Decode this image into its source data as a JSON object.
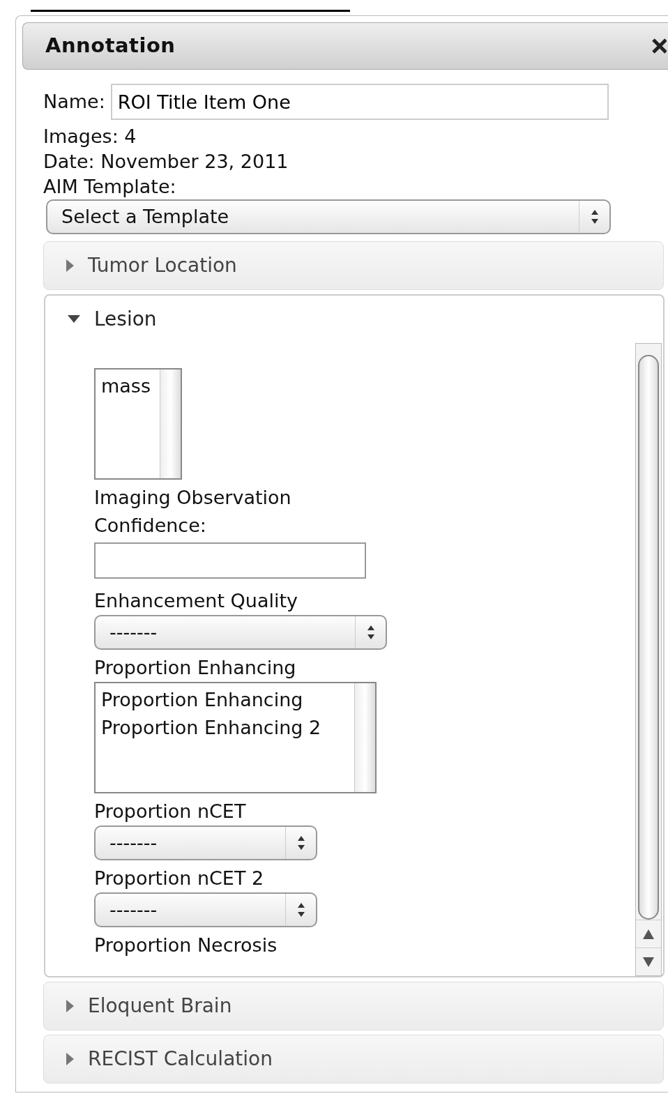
{
  "dialog": {
    "title": "Annotation",
    "name_label": "Name:",
    "name_value": "ROI Title Item One",
    "images": "Images: 4",
    "date": "Date: November 23, 2011",
    "template_label": "AIM Template:",
    "template_value": "Select a Template"
  },
  "sections": [
    {
      "title": "Tumor Location",
      "expanded": false
    },
    {
      "title": "Lesion",
      "expanded": true,
      "fields": [
        {
          "kind": "listbox",
          "options": [
            "mass"
          ]
        },
        {
          "kind": "text",
          "label": "Imaging Observation Confidence:"
        },
        {
          "kind": "select",
          "label": "Enhancement Quality",
          "value": "-------"
        },
        {
          "kind": "listbox",
          "label": "Proportion Enhancing",
          "options": [
            "Proportion Enhancing",
            "Proportion Enhancing 2"
          ]
        },
        {
          "kind": "select",
          "label": "Proportion nCET",
          "value": "-------"
        },
        {
          "kind": "select",
          "label": "Proportion nCET 2",
          "value": "-------"
        },
        {
          "kind": "label",
          "label": "Proportion Necrosis"
        }
      ]
    },
    {
      "title": "Eloquent Brain",
      "expanded": false
    },
    {
      "title": "RECIST Calculation",
      "expanded": false
    }
  ]
}
